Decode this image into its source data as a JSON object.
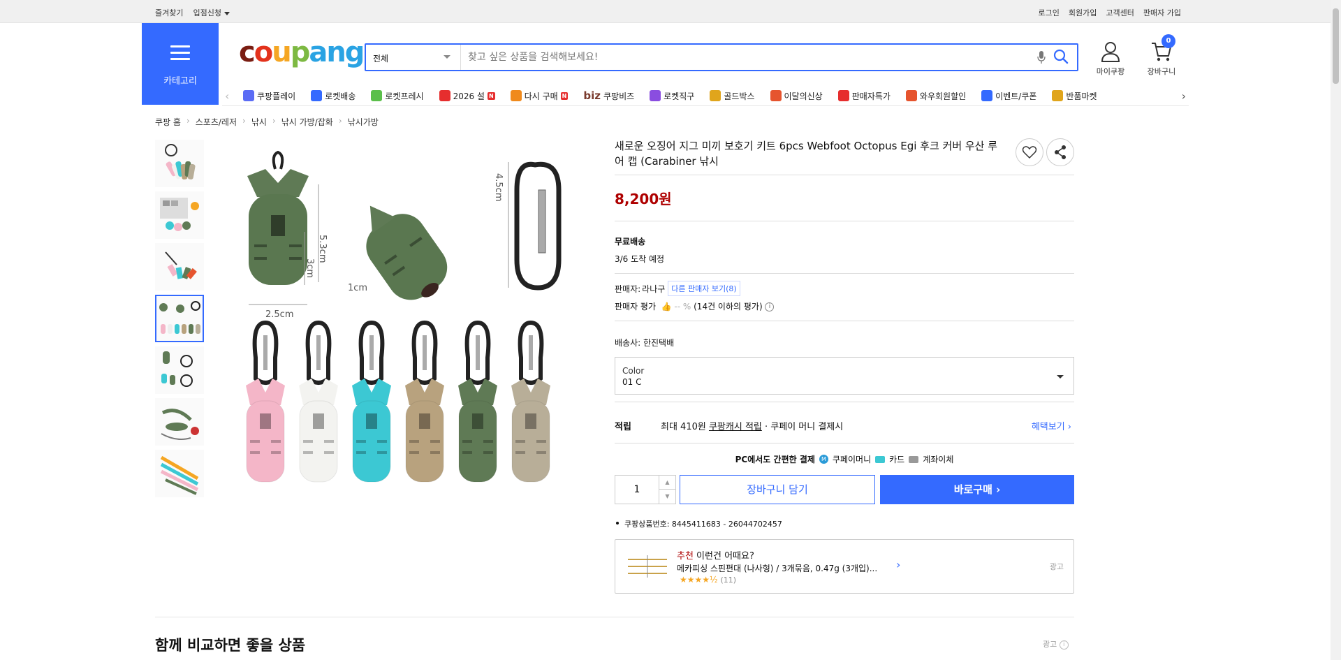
{
  "topbar": {
    "bookmark": "즐겨찾기",
    "vendor_apply": "입점신청",
    "login": "로그인",
    "signup": "회원가입",
    "support": "고객센터",
    "seller_signup": "판매자 가입"
  },
  "header": {
    "category_label": "카테고리",
    "logo_parts": [
      "c",
      "o",
      "u",
      "p",
      "ang"
    ],
    "search_scope": "전체",
    "search_placeholder": "찾고 싶은 상품을 검색해보세요!",
    "mycoupang": "마이쿠팡",
    "cart": "장바구니",
    "cart_count": "0"
  },
  "catnav": {
    "items": [
      {
        "label": "쿠팡플레이",
        "icon": "play-icon",
        "color": "#5b6cf5"
      },
      {
        "label": "로켓배송",
        "icon": "rocket-icon",
        "color": "#346aff"
      },
      {
        "label": "로켓프레시",
        "icon": "rocket-fresh-icon",
        "color": "#5bbf4b"
      },
      {
        "label": "2026 설",
        "icon": "gift-icon",
        "color": "#e62e2e",
        "badge": "N"
      },
      {
        "label": "다시 구매",
        "icon": "home-icon",
        "color": "#f08a1c",
        "badge": "N"
      },
      {
        "label": "쿠팡비즈",
        "icon": "biz-icon",
        "color": "#7a3b2e",
        "prefix": "biz"
      },
      {
        "label": "로켓직구",
        "icon": "globe-icon",
        "color": "#8a4de0"
      },
      {
        "label": "골드박스",
        "icon": "goldbox-icon",
        "color": "#e0a51c"
      },
      {
        "label": "이달의신상",
        "icon": "new-icon",
        "color": "#e6542e"
      },
      {
        "label": "판매자특가",
        "icon": "percent-icon",
        "color": "#e62e2e"
      },
      {
        "label": "와우회원할인",
        "icon": "wow-icon",
        "color": "#e6542e"
      },
      {
        "label": "이벤트/쿠폰",
        "icon": "coupon-icon",
        "color": "#346aff"
      },
      {
        "label": "반품마켓",
        "icon": "market-icon",
        "color": "#e0a51c"
      }
    ]
  },
  "breadcrumbs": [
    "쿠팡 홈",
    "스포츠/레저",
    "낚시",
    "낚시 가방/잡화",
    "낚시가방"
  ],
  "product": {
    "title": "새로운 오징어 지그 미끼 보호기 키트 6pcs Webfoot Octopus Egi 후크 커버 우산 루어 캡 (Carabiner 낚시",
    "price": "8,200원",
    "shipping_title": "무료배송",
    "shipping_date": "3/6 도착 예정",
    "seller_label": "판매자:",
    "seller_name": "라나구",
    "other_sellers": "다른 판매자 보기(8)",
    "rating_label": "판매자 평가",
    "rating_value": "👍 -- %",
    "rating_note": "(14건 이하의 평가)",
    "courier": "배송사:  한진택배",
    "option_label": "Color",
    "option_value": "01 C",
    "reward_title": "적립",
    "reward_prefix": "최대 410원",
    "reward_link": "쿠팡캐시 적립",
    "reward_suffix": " · 쿠페이 머니 결제시",
    "reward_more": "혜택보기 ›",
    "pcpay_title": "PC에서도 간편한 결제",
    "pay_methods": [
      "쿠페이머니",
      "카드",
      "계좌이체"
    ],
    "quantity": "1",
    "add_to_cart": "장바구니 담기",
    "buy_now": "바로구매 ›",
    "product_number": "쿠팡상품번호: 8445411683 - 26044702457"
  },
  "recommend": {
    "label_red": "추천",
    "label_rest": " 이런건 어때요?",
    "name": "메카피싱 스핀편대 (나사형) / 3개묶음, 0.47g (3개입)...",
    "stars": "★★★★½",
    "count": "(11)",
    "ad": "광고"
  },
  "compare": {
    "title": "함께 비교하면 좋을 상품",
    "ad": "광고"
  },
  "image_labels": {
    "h": "5.3cm",
    "w": "2.5cm",
    "inner": "3cm",
    "hole": "1cm",
    "clip": "4.5cm"
  },
  "colors": {
    "accent": "#346aff",
    "price": "#ae0000",
    "lures": [
      "#f4b6c8",
      "#f3f3f0",
      "#3cc8d3",
      "#b8a27e",
      "#5f7a55",
      "#b8ae98"
    ]
  }
}
